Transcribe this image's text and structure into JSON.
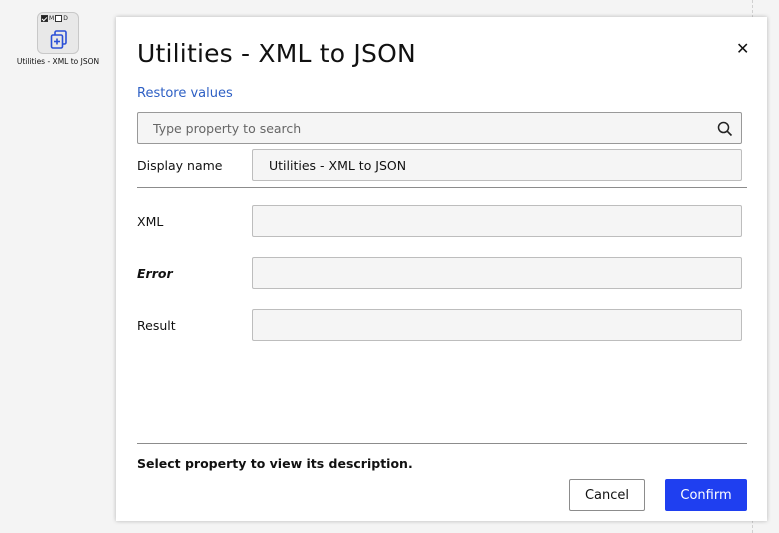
{
  "canvas": {
    "node": {
      "flag_m": "M",
      "flag_d": "D",
      "icon": "copy-plus-icon",
      "label": "Utilities - XML to JSON"
    }
  },
  "dialog": {
    "title": "Utilities - XML to JSON",
    "close_icon": "close-icon",
    "restore_link": "Restore values",
    "search": {
      "placeholder": "Type property to search",
      "icon": "search-icon"
    },
    "display_name": {
      "label": "Display name",
      "value": "Utilities - XML to JSON"
    },
    "properties": [
      {
        "label": "XML",
        "value": ""
      },
      {
        "label": "Error",
        "value": ""
      },
      {
        "label": "Result",
        "value": ""
      }
    ],
    "description": "Select property to view its description.",
    "cancel_label": "Cancel",
    "confirm_label": "Confirm"
  },
  "colors": {
    "link": "#2d5fc4",
    "primary_button": "#1f3ff0"
  }
}
